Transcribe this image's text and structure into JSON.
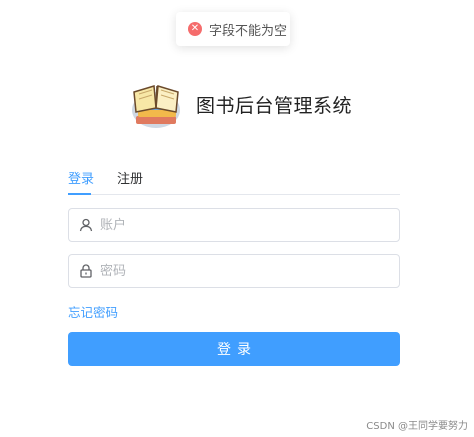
{
  "toast": {
    "icon": "close-circle-icon",
    "message": "字段不能为空"
  },
  "brand": {
    "logo": "books-logo",
    "title": "图书后台管理系统"
  },
  "tabs": [
    {
      "label": "登录",
      "active": true
    },
    {
      "label": "注册",
      "active": false
    }
  ],
  "form": {
    "account": {
      "icon": "user-icon",
      "placeholder": "账户",
      "value": ""
    },
    "password": {
      "icon": "lock-icon",
      "placeholder": "密码",
      "value": ""
    },
    "forgot_label": "忘记密码",
    "submit_label": "登录"
  },
  "watermark": "CSDN @王同学要努力",
  "colors": {
    "accent": "#409eff",
    "error": "#f56c6c",
    "border": "#dcdfe6"
  }
}
